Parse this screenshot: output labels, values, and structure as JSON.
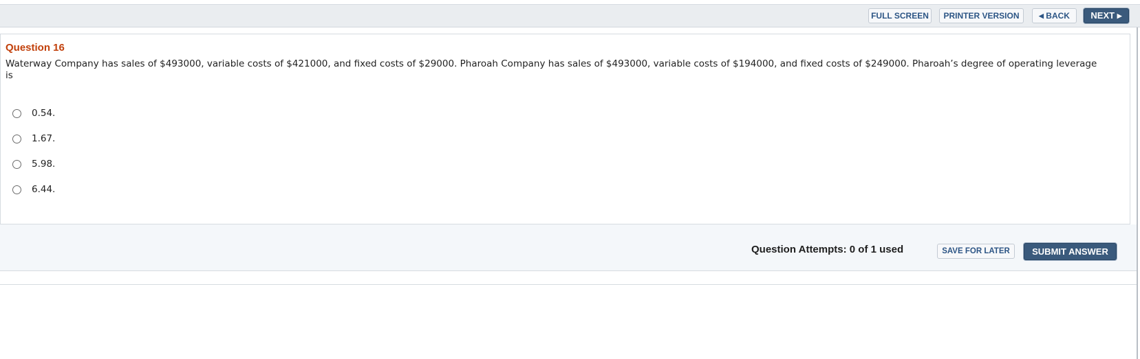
{
  "toolbar": {
    "full_screen": "FULL SCREEN",
    "printer_version": "PRINTER VERSION",
    "back": "BACK",
    "next": "NEXT"
  },
  "question": {
    "title": "Question 16",
    "text": "Waterway Company has sales of $493000, variable costs of $421000, and fixed costs of $29000. Pharoah Company has sales of $493000, variable costs of $194000, and fixed costs of $249000. Pharoah’s degree of operating leverage is",
    "options": [
      "0.54.",
      "1.67.",
      "5.98.",
      "6.44."
    ]
  },
  "footer": {
    "attempts": "Question Attempts: 0 of 1 used",
    "save_for_later": "SAVE FOR LATER",
    "submit_answer": "SUBMIT ANSWER"
  },
  "colors": {
    "accent_title": "#c2410c",
    "primary_button": "#3a5a7c",
    "toolbar_bg": "#eaedf0"
  }
}
